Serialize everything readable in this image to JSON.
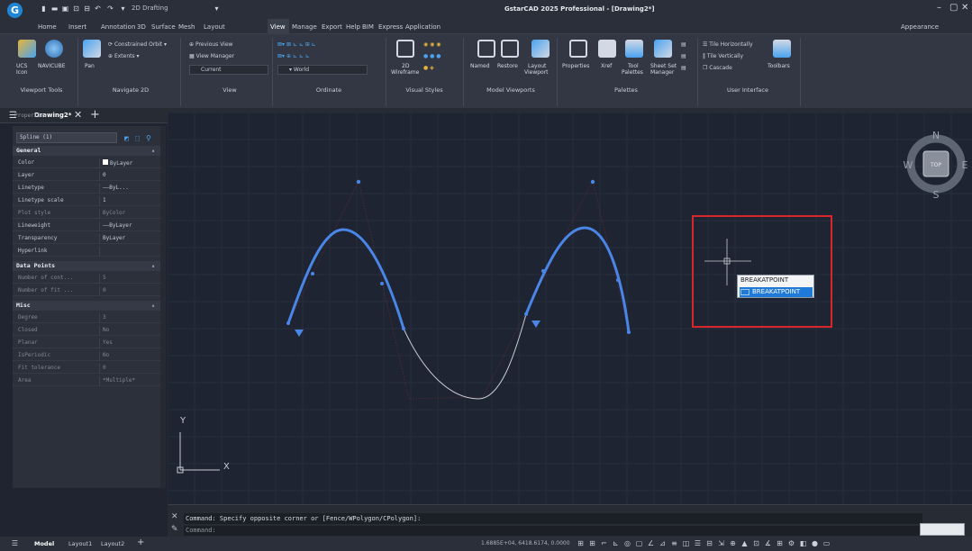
{
  "titlebar": {
    "workspace": "2D Drafting",
    "title": "GstarCAD 2025 Professional - [Drawing2*]",
    "logo": "G",
    "win_min": "–",
    "win_max": "▢",
    "win_close": "✕"
  },
  "menu": {
    "tabs": [
      "Home",
      "Insert",
      "Annotation",
      "3D",
      "Surface",
      "Mesh",
      "Layout",
      "View",
      "Manage",
      "Export",
      "Help",
      "BIM",
      "Express",
      "Application"
    ],
    "active": "View",
    "appearance": "Appearance"
  },
  "ribbon": {
    "panels": [
      "Viewport Tools",
      "Navigate 2D",
      "View",
      "Ordinate",
      "Visual Styles",
      "Model Viewports",
      "Palettes",
      "User Interface"
    ],
    "viewport_tools": {
      "ucs": "UCS",
      "ucs2": "Icon",
      "navicube": "NAVICUBE",
      "pan": "Pan"
    },
    "navigate": {
      "orbit": "Constrained Orbit",
      "extents": "Extents"
    },
    "view": {
      "prev": "Previous View",
      "manager": "View Manager",
      "current": "Current"
    },
    "ordinate": {
      "world": "World"
    },
    "visual": {
      "mode": "2D",
      "mode2": "Wireframe"
    },
    "viewports": {
      "named": "Named",
      "restore": "Restore",
      "layout": "Layout",
      "layout2": "Viewport"
    },
    "palettes": {
      "properties": "Properties",
      "xref": "Xref",
      "tool": "Tool",
      "tool2": "Palettes",
      "sheet": "Sheet Set",
      "sheet2": "Manager"
    },
    "ui": {
      "horiz": "Tile Horizontally",
      "vert": "Tile Vertically",
      "cascade": "Cascade",
      "toolbars": "Toolbars"
    }
  },
  "doctab": {
    "name": "Drawing2*",
    "close": "✕",
    "add": "+"
  },
  "properties": {
    "title": "Properties",
    "selection": "Spline (1)",
    "sections": [
      {
        "name": "General",
        "rows": [
          {
            "k": "Color",
            "v": "ByLayer",
            "swatch": "#ffffff"
          },
          {
            "k": "Layer",
            "v": "0"
          },
          {
            "k": "Linetype",
            "v": "——ByL..."
          },
          {
            "k": "Linetype scale",
            "v": "1"
          },
          {
            "k": "Plot style",
            "v": "ByColor",
            "dim": true
          },
          {
            "k": "Lineweight",
            "v": "——ByLayer"
          },
          {
            "k": "Transparency",
            "v": "ByLayer"
          },
          {
            "k": "Hyperlink",
            "v": ""
          }
        ]
      },
      {
        "name": "Data Points",
        "rows": [
          {
            "k": "Number of cont...",
            "v": "5",
            "dim": true
          },
          {
            "k": "Number of fit ...",
            "v": "0",
            "dim": true
          }
        ]
      },
      {
        "name": "Misc",
        "rows": [
          {
            "k": "Degree",
            "v": "3",
            "dim": true
          },
          {
            "k": "Closed",
            "v": "No",
            "dim": true
          },
          {
            "k": "Planar",
            "v": "Yes",
            "dim": true
          },
          {
            "k": "IsPeriodic",
            "v": "No",
            "dim": true
          },
          {
            "k": "Fit tolerance",
            "v": "0",
            "dim": true
          },
          {
            "k": "Area",
            "v": "*Multiple*",
            "dim": true
          }
        ]
      }
    ]
  },
  "canvas": {
    "viewcube": {
      "n": "N",
      "s": "S",
      "w": "W",
      "e": "E",
      "face": "TOP"
    },
    "ucs": {
      "x": "X",
      "y": "Y"
    },
    "context_menu": {
      "items": [
        "BREAKATPOINT",
        "BREAKATPOINT"
      ],
      "highlight_color": "#1e7ad6"
    },
    "selection_box_color": "#d9262c",
    "spline_color": "#4a86e8"
  },
  "command": {
    "line1": "Command: Specify opposite corner or [Fence/WPolygon/CPolygon]:",
    "line2": "Command:"
  },
  "status": {
    "tabs": [
      "Model",
      "Layout1",
      "Layout2"
    ],
    "coords": "1.6885E+04, 6418.6174, 0.0000"
  }
}
